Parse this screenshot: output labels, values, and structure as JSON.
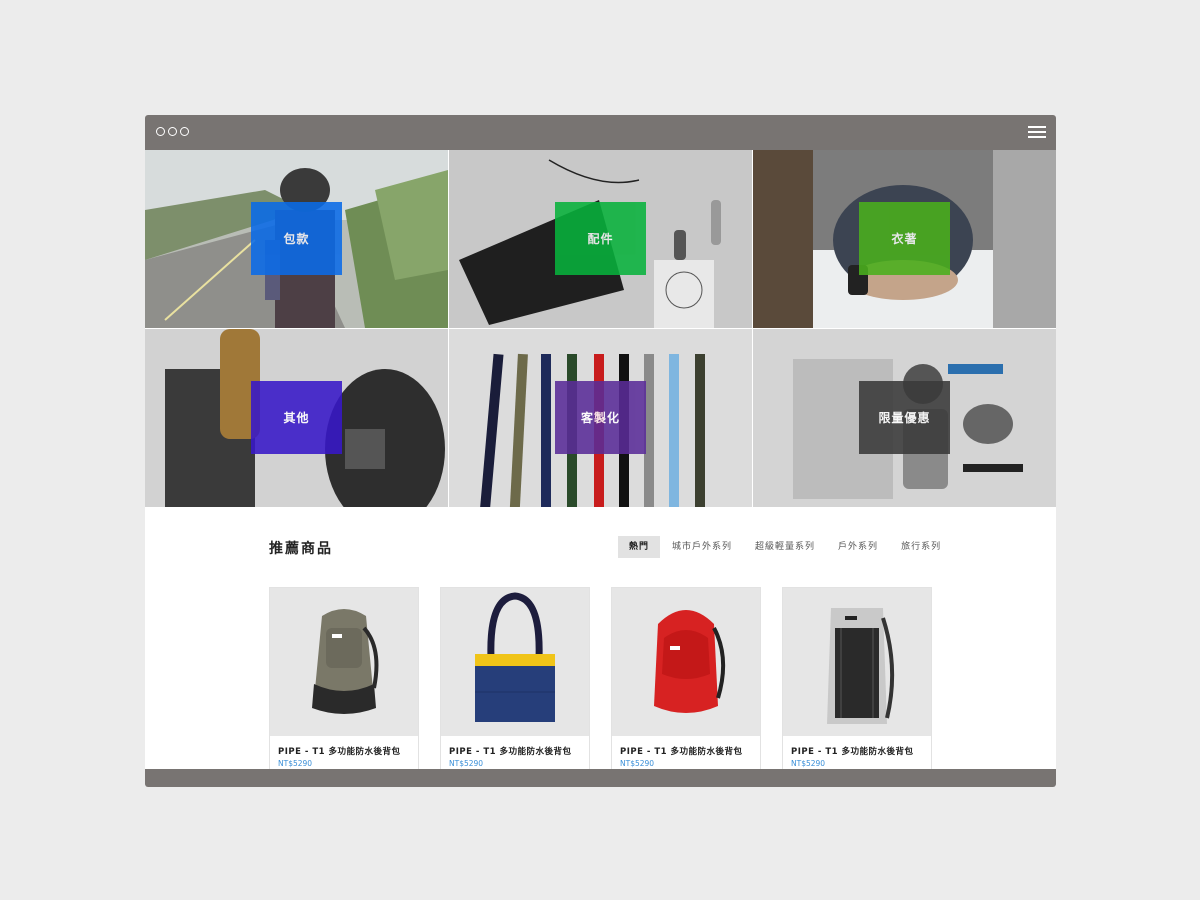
{
  "categories": [
    {
      "label": "包款",
      "color": "#0a6be8"
    },
    {
      "label": "配件",
      "color": "#08b23c"
    },
    {
      "label": "衣著",
      "color": "#4aaf1c"
    },
    {
      "label": "其他",
      "color": "#3818c8"
    },
    {
      "label": "客製化",
      "color": "#5a2c98"
    },
    {
      "label": "限量優惠",
      "color": "#3a3a3a"
    }
  ],
  "section": {
    "title": "推薦商品"
  },
  "tabs": [
    {
      "label": "熱門"
    },
    {
      "label": "城市戶外系列"
    },
    {
      "label": "超級輕量系列"
    },
    {
      "label": "戶外系列"
    },
    {
      "label": "旅行系列"
    }
  ],
  "products": [
    {
      "name": "PIPE - T1 多功能防水後背包",
      "price": "NT$5290"
    },
    {
      "name": "PIPE - T1 多功能防水後背包",
      "price": "NT$5290"
    },
    {
      "name": "PIPE - T1 多功能防水後背包",
      "price": "NT$5290"
    },
    {
      "name": "PIPE - T1 多功能防水後背包",
      "price": "NT$5290"
    }
  ]
}
